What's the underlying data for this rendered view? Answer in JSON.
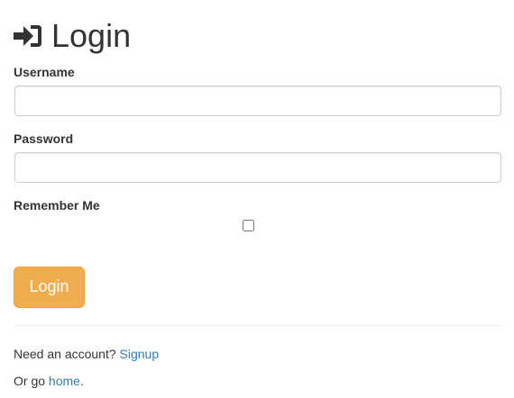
{
  "header": {
    "title": "Login",
    "icon": "sign-in-icon"
  },
  "form": {
    "username_label": "Username",
    "username_value": "",
    "password_label": "Password",
    "password_value": "",
    "remember_label": "Remember Me",
    "remember_checked": false,
    "submit_label": "Login"
  },
  "footer": {
    "account_prompt": "Need an account? ",
    "signup_link": "Signup",
    "home_prompt": "Or go ",
    "home_link": "home",
    "home_suffix": "."
  },
  "colors": {
    "button_bg": "#f0ad4e",
    "button_border": "#eea236",
    "link": "#337ab7",
    "text": "#333333",
    "input_border": "#cccccc"
  }
}
